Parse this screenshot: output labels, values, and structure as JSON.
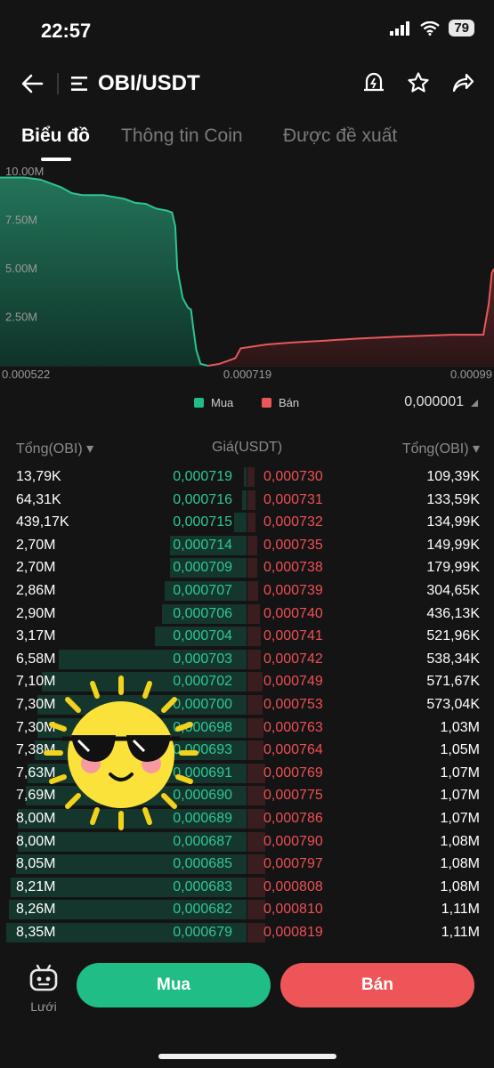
{
  "status": {
    "time": "22:57",
    "battery": "79"
  },
  "nav": {
    "pair": "OBI/USDT"
  },
  "tabs": [
    {
      "label": "Biểu đồ",
      "active": true
    },
    {
      "label": "Thông tin Coin",
      "active": false
    },
    {
      "label": "Được đề xuất",
      "active": false
    }
  ],
  "chart_data": {
    "type": "area",
    "y_ticks": [
      "10.00M",
      "7.50M",
      "5.00M",
      "2.50M"
    ],
    "x_ticks": [
      "0.000522",
      "0.000719",
      "0.00099"
    ],
    "ylim": [
      0,
      10000000
    ],
    "series": [
      {
        "name": "Mua",
        "color": "#1c9c6e",
        "points": [
          [
            0.000522,
            9.7
          ],
          [
            0.000545,
            9.7
          ],
          [
            0.00056,
            9.6
          ],
          [
            0.00057,
            9.4
          ],
          [
            0.00058,
            9.2
          ],
          [
            0.00059,
            8.9
          ],
          [
            0.0006,
            8.8
          ],
          [
            0.00062,
            8.8
          ],
          [
            0.00064,
            8.6
          ],
          [
            0.00065,
            8.4
          ],
          [
            0.00066,
            8.35
          ],
          [
            0.00067,
            8.1
          ],
          [
            0.00068,
            8.0
          ],
          [
            0.000685,
            7.9
          ],
          [
            0.000688,
            7.2
          ],
          [
            0.00069,
            5.0
          ],
          [
            0.000695,
            3.5
          ],
          [
            0.0007,
            3.0
          ],
          [
            0.000703,
            2.9
          ],
          [
            0.000705,
            2.0
          ],
          [
            0.000708,
            0.8
          ],
          [
            0.000712,
            0.1
          ],
          [
            0.000719,
            0.0
          ]
        ]
      },
      {
        "name": "Bán",
        "color": "#c74246",
        "points": [
          [
            0.000719,
            0.0
          ],
          [
            0.00073,
            0.1
          ],
          [
            0.000745,
            0.4
          ],
          [
            0.00075,
            0.9
          ],
          [
            0.000775,
            1.1
          ],
          [
            0.0008,
            1.2
          ],
          [
            0.00083,
            1.3
          ],
          [
            0.00086,
            1.4
          ],
          [
            0.0009,
            1.5
          ],
          [
            0.00095,
            1.6
          ],
          [
            0.00098,
            1.6
          ],
          [
            0.000985,
            3.2
          ],
          [
            0.000988,
            4.8
          ],
          [
            0.00099,
            5.0
          ]
        ]
      }
    ]
  },
  "legend": {
    "buy": "Mua",
    "sell": "Bán",
    "precision": "0,000001"
  },
  "book_header": {
    "left": "Tổng(OBI)",
    "mid": "Giá(USDT)",
    "right": "Tổng(OBI)"
  },
  "orderbook": [
    {
      "bt": "13,79K",
      "bp": "0,000719",
      "sp": "0,000730",
      "st": "109,39K",
      "bd": 0.01,
      "sd": 0.05
    },
    {
      "bt": "64,31K",
      "bp": "0,000716",
      "sp": "0,000731",
      "st": "133,59K",
      "bd": 0.02,
      "sd": 0.06
    },
    {
      "bt": "439,17K",
      "bp": "0,000715",
      "sp": "0,000732",
      "st": "134,99K",
      "bd": 0.05,
      "sd": 0.06
    },
    {
      "bt": "2,70M",
      "bp": "0,000714",
      "sp": "0,000735",
      "st": "149,99K",
      "bd": 0.32,
      "sd": 0.07
    },
    {
      "bt": "2,70M",
      "bp": "0,000709",
      "sp": "0,000738",
      "st": "179,99K",
      "bd": 0.32,
      "sd": 0.07
    },
    {
      "bt": "2,86M",
      "bp": "0,000707",
      "sp": "0,000739",
      "st": "304,65K",
      "bd": 0.34,
      "sd": 0.08
    },
    {
      "bt": "2,90M",
      "bp": "0,000706",
      "sp": "0,000740",
      "st": "436,13K",
      "bd": 0.35,
      "sd": 0.09
    },
    {
      "bt": "3,17M",
      "bp": "0,000704",
      "sp": "0,000741",
      "st": "521,96K",
      "bd": 0.38,
      "sd": 0.1
    },
    {
      "bt": "6,58M",
      "bp": "0,000703",
      "sp": "0,000742",
      "st": "538,34K",
      "bd": 0.78,
      "sd": 0.1
    },
    {
      "bt": "7,10M",
      "bp": "0,000702",
      "sp": "0,000749",
      "st": "571,67K",
      "bd": 0.85,
      "sd": 0.11
    },
    {
      "bt": "7,30M",
      "bp": "0,000700",
      "sp": "0,000753",
      "st": "573,04K",
      "bd": 0.87,
      "sd": 0.11
    },
    {
      "bt": "7,30M",
      "bp": "0,000698",
      "sp": "0,000763",
      "st": "1,03M",
      "bd": 0.87,
      "sd": 0.12
    },
    {
      "bt": "7,38M",
      "bp": "0,000693",
      "sp": "0,000764",
      "st": "1,05M",
      "bd": 0.88,
      "sd": 0.12
    },
    {
      "bt": "7,63M",
      "bp": "0,000691",
      "sp": "0,000769",
      "st": "1,07M",
      "bd": 0.91,
      "sd": 0.13
    },
    {
      "bt": "7,69M",
      "bp": "0,000690",
      "sp": "0,000775",
      "st": "1,07M",
      "bd": 0.92,
      "sd": 0.13
    },
    {
      "bt": "8,00M",
      "bp": "0,000689",
      "sp": "0,000786",
      "st": "1,07M",
      "bd": 0.95,
      "sd": 0.13
    },
    {
      "bt": "8,00M",
      "bp": "0,000687",
      "sp": "0,000790",
      "st": "1,08M",
      "bd": 0.95,
      "sd": 0.13
    },
    {
      "bt": "8,05M",
      "bp": "0,000685",
      "sp": "0,000797",
      "st": "1,08M",
      "bd": 0.96,
      "sd": 0.13
    },
    {
      "bt": "8,21M",
      "bp": "0,000683",
      "sp": "0,000808",
      "st": "1,08M",
      "bd": 0.98,
      "sd": 0.13
    },
    {
      "bt": "8,26M",
      "bp": "0,000682",
      "sp": "0,000810",
      "st": "1,11M",
      "bd": 0.99,
      "sd": 0.13
    },
    {
      "bt": "8,35M",
      "bp": "0,000679",
      "sp": "0,000819",
      "st": "1,11M",
      "bd": 1.0,
      "sd": 0.13
    }
  ],
  "bottom": {
    "grid_label": "Lưới",
    "buy": "Mua",
    "sell": "Bán"
  },
  "colors": {
    "buy": "#20bd86",
    "sell": "#ee5558",
    "buy_bar": "#14362c",
    "sell_bar": "#3a1d1e"
  }
}
